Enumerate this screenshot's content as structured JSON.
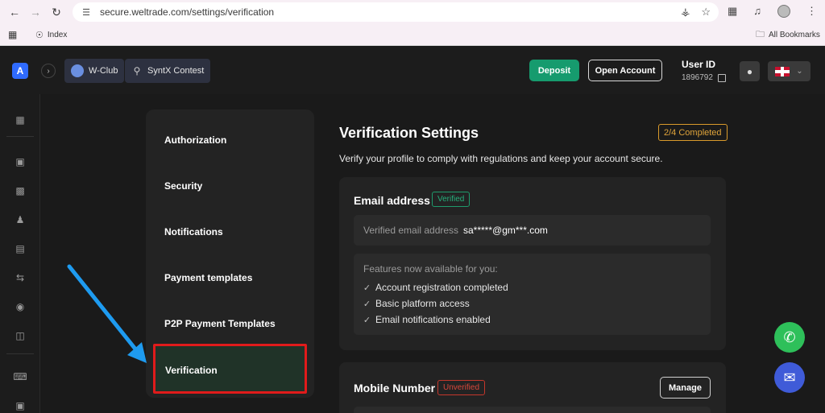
{
  "browser": {
    "url": "secure.weltrade.com/settings/verification",
    "bookmark_index": "Index",
    "bookmark_all": "All Bookmarks"
  },
  "header": {
    "logo_letter": "A",
    "club_label": "W-Club",
    "contest_label": "SyntX Contest",
    "deposit_label": "Deposit",
    "open_account_label": "Open Account",
    "user_id_label": "User ID",
    "user_id_value": "1896792"
  },
  "settings_nav": {
    "items": [
      {
        "label": "Authorization"
      },
      {
        "label": "Security"
      },
      {
        "label": "Notifications"
      },
      {
        "label": "Payment templates"
      },
      {
        "label": "P2P Payment Templates"
      },
      {
        "label": "Verification"
      }
    ],
    "active": "Verification"
  },
  "main": {
    "title": "Verification Settings",
    "progress": "2/4 Completed",
    "subtitle": "Verify your profile to comply with regulations and keep your account secure.",
    "email_card": {
      "title": "Email address",
      "status": "Verified",
      "email_label": "Verified email address",
      "email_value": "sa*****@gm***.com",
      "features_title": "Features now available for you:",
      "features": [
        "Account registration completed",
        "Basic platform access",
        "Email notifications enabled"
      ]
    },
    "mobile_card": {
      "title": "Mobile Number",
      "status": "Unverified",
      "manage_label": "Manage"
    }
  },
  "colors": {
    "accent_green": "#169b6e",
    "verified": "#25b07b",
    "unverified": "#d8483b",
    "warning": "#e0a43a",
    "highlight_box": "#e01b1b",
    "arrow": "#1e9bf0"
  }
}
